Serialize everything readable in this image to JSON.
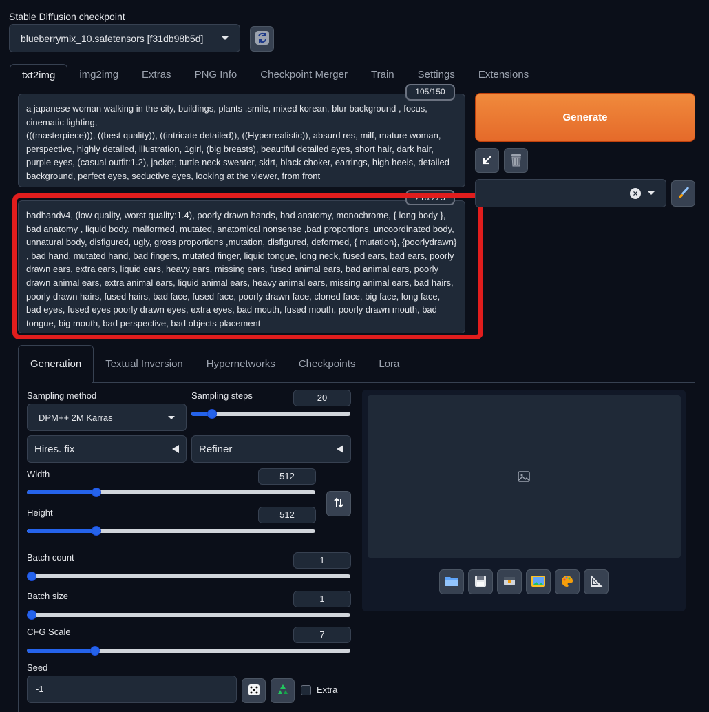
{
  "checkpoint": {
    "label": "Stable Diffusion checkpoint",
    "value": "blueberrymix_10.safetensors [f31db98b5d]",
    "refresh_icon": "refresh-icon"
  },
  "tabs": [
    "txt2img",
    "img2img",
    "Extras",
    "PNG Info",
    "Checkpoint Merger",
    "Train",
    "Settings",
    "Extensions"
  ],
  "prompt": {
    "counter": "105/150",
    "line1": "a japanese woman walking in the city, buildings, plants ,smile, mixed korean, blur background , focus, cinematic lighting,",
    "line2": "(((masterpiece))), ((best quality)), ((intricate detailed)), ((Hyperrealistic)), absurd res, milf, mature woman, perspective, highly detailed, illustration, 1girl, (big breasts), beautiful detailed eyes, short hair, dark hair, purple eyes, (casual outfit:1.2), jacket, turtle neck sweater, skirt, black choker, earrings, high heels, detailed background, perfect eyes, seductive eyes, looking at the viewer, from front"
  },
  "negative_prompt": {
    "counter": "218/225",
    "text": "badhandv4, (low quality, worst quality:1.4), poorly drawn hands, bad anatomy, monochrome, { long body }, bad anatomy , liquid body, malformed, mutated, anatomical nonsense ,bad proportions, uncoordinated body, unnatural body, disfigured, ugly, gross proportions ,mutation, disfigured, deformed, { mutation}, {poorlydrawn} , bad hand, mutated hand, bad fingers, mutated finger, liquid tongue, long neck, fused ears, bad ears, poorly drawn ears, extra ears, liquid ears, heavy ears, missing ears, fused animal ears, bad animal ears, poorly drawn animal ears, extra animal ears, liquid animal ears, heavy animal ears, missing animal ears, bad hairs, poorly drawn hairs, fused hairs, bad face, fused face, poorly drawn face, cloned face, big face, long face, bad eyes, fused eyes poorly drawn eyes, extra eyes, bad mouth, fused mouth, poorly drawn mouth, bad tongue, big mouth, bad perspective, bad objects placement"
  },
  "generate_label": "Generate",
  "sub_tabs": [
    "Generation",
    "Textual Inversion",
    "Hypernetworks",
    "Checkpoints",
    "Lora"
  ],
  "sampling": {
    "method_label": "Sampling method",
    "method_value": "DPM++ 2M Karras",
    "steps_label": "Sampling steps",
    "steps_value": "20",
    "steps_fraction": 0.13
  },
  "hires_label": "Hires. fix",
  "refiner_label": "Refiner",
  "width": {
    "label": "Width",
    "value": "512",
    "fraction": 0.24
  },
  "height": {
    "label": "Height",
    "value": "512",
    "fraction": 0.24
  },
  "batch_count": {
    "label": "Batch count",
    "value": "1",
    "fraction": 0.0
  },
  "batch_size": {
    "label": "Batch size",
    "value": "1",
    "fraction": 0.0
  },
  "cfg": {
    "label": "CFG Scale",
    "value": "7",
    "fraction": 0.21
  },
  "seed": {
    "label": "Seed",
    "value": "-1",
    "extra_label": "Extra"
  },
  "colors": {
    "accent": "#2563eb",
    "generate": "#ea7434",
    "highlight": "#e11d1d",
    "background": "#0b0f19"
  }
}
